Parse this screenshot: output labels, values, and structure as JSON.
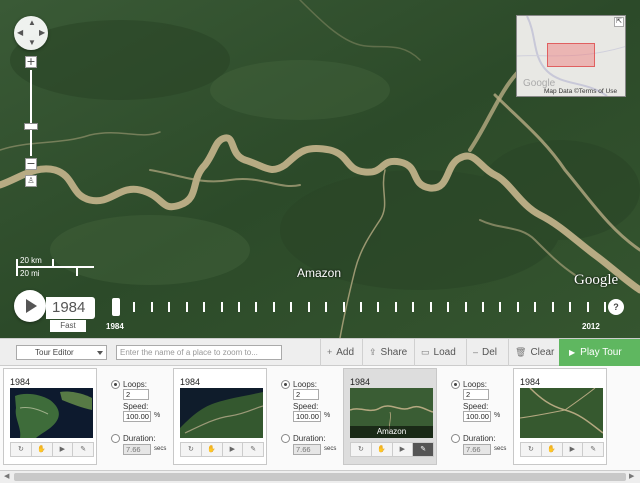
{
  "map": {
    "place_label": "Amazon",
    "logo_text": "Google",
    "scale_km": "20 km",
    "scale_mi": "20 mi",
    "minimap": {
      "logo_text": "Google",
      "attribution": "Map Data ©Terms of Use"
    }
  },
  "timeline": {
    "current_year": "1984",
    "speed": "Fast",
    "start_year": "1984",
    "end_year": "2012",
    "help": "?",
    "position_fraction": 0
  },
  "toolbar": {
    "mode": "Tour Editor",
    "search_placeholder": "Enter the name of a place to zoom to...",
    "add": "Add",
    "share": "Share",
    "load": "Load",
    "del": "Del",
    "clear": "Clear",
    "play_tour": "Play Tour"
  },
  "tour": {
    "frames": [
      {
        "year": "1984",
        "label": ""
      },
      {
        "year": "1984",
        "label": ""
      },
      {
        "year": "1984",
        "label": "Amazon"
      },
      {
        "year": "1984",
        "label": ""
      }
    ],
    "transitions": [
      {
        "loops_label": "Loops:",
        "loops": "2",
        "speed_label": "Speed:",
        "speed": "100.00",
        "speed_unit": "%",
        "duration_label": "Duration:",
        "duration": "7.66",
        "duration_unit": "secs"
      },
      {
        "loops_label": "Loops:",
        "loops": "2",
        "speed_label": "Speed:",
        "speed": "100.00",
        "speed_unit": "%",
        "duration_label": "Duration:",
        "duration": "7.66",
        "duration_unit": "secs"
      },
      {
        "loops_label": "Loops:",
        "loops": "2",
        "speed_label": "Speed:",
        "speed": "100.00",
        "speed_unit": "%",
        "duration_label": "Duration:",
        "duration": "7.66",
        "duration_unit": "secs"
      }
    ]
  },
  "colors": {
    "play_tour_bg": "#5fb760",
    "forest": "#2f4f2c",
    "river": "#b7ab83"
  }
}
